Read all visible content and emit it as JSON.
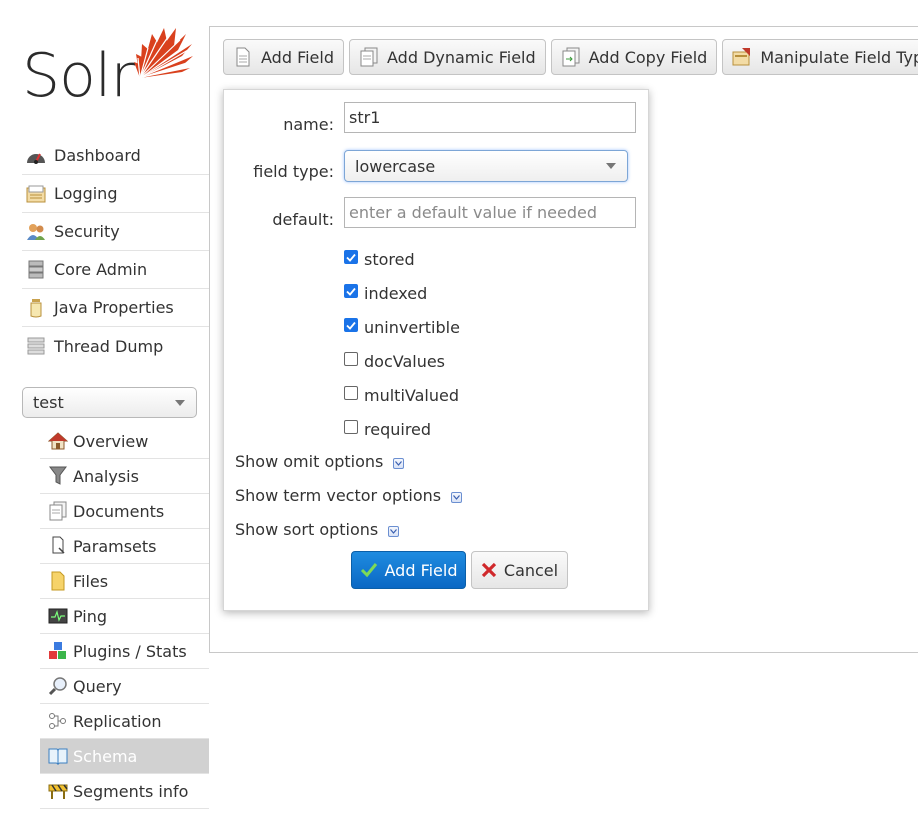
{
  "brand": {
    "name": "Solr",
    "accent_color": "#d9411e"
  },
  "main_nav": [
    {
      "label": "Dashboard",
      "icon": "dashboard-icon"
    },
    {
      "label": "Logging",
      "icon": "logging-icon"
    },
    {
      "label": "Security",
      "icon": "security-icon"
    },
    {
      "label": "Core Admin",
      "icon": "core-admin-icon"
    },
    {
      "label": "Java Properties",
      "icon": "java-properties-icon"
    },
    {
      "label": "Thread Dump",
      "icon": "thread-dump-icon"
    }
  ],
  "core_selector": {
    "value": "test"
  },
  "core_nav": [
    {
      "label": "Overview",
      "icon": "overview-icon"
    },
    {
      "label": "Analysis",
      "icon": "analysis-icon"
    },
    {
      "label": "Documents",
      "icon": "documents-icon"
    },
    {
      "label": "Paramsets",
      "icon": "paramsets-icon"
    },
    {
      "label": "Files",
      "icon": "files-icon"
    },
    {
      "label": "Ping",
      "icon": "ping-icon"
    },
    {
      "label": "Plugins / Stats",
      "icon": "plugins-icon"
    },
    {
      "label": "Query",
      "icon": "query-icon"
    },
    {
      "label": "Replication",
      "icon": "replication-icon"
    },
    {
      "label": "Schema",
      "icon": "schema-icon",
      "active": true
    },
    {
      "label": "Segments info",
      "icon": "segments-icon"
    }
  ],
  "toolbar": {
    "add_field": "Add Field",
    "add_dynamic_field": "Add Dynamic Field",
    "add_copy_field": "Add Copy Field",
    "manipulate_field_type": "Manipulate Field Type"
  },
  "dialog": {
    "name_label": "name:",
    "name_value": "str1",
    "field_type_label": "field type:",
    "field_type_value": "lowercase",
    "default_label": "default:",
    "default_value": "",
    "default_placeholder": "enter a default value if needed",
    "checkboxes": [
      {
        "label": "stored",
        "checked": true
      },
      {
        "label": "indexed",
        "checked": true
      },
      {
        "label": "uninvertible",
        "checked": true
      },
      {
        "label": "docValues",
        "checked": false
      },
      {
        "label": "multiValued",
        "checked": false
      },
      {
        "label": "required",
        "checked": false
      }
    ],
    "show_omit_options": "Show omit options",
    "show_term_vector_options": "Show term vector options",
    "show_sort_options": "Show sort options",
    "submit_label": "Add Field",
    "cancel_label": "Cancel"
  }
}
